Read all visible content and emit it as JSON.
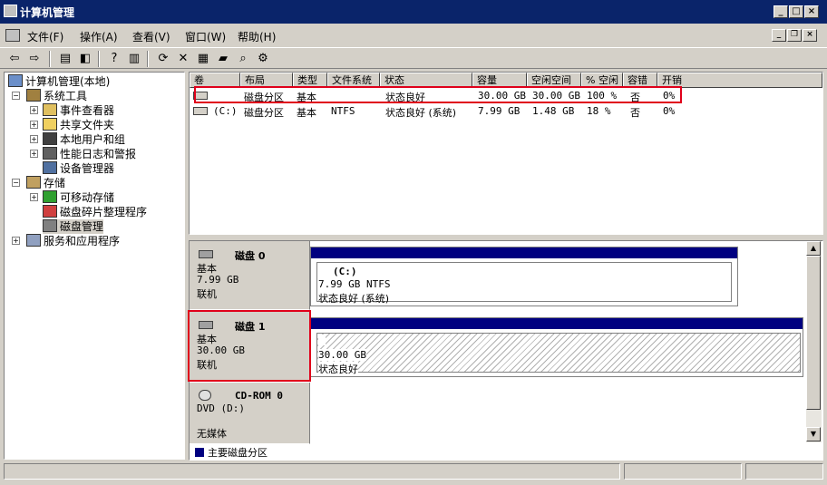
{
  "window": {
    "title": "计算机管理"
  },
  "menu": [
    {
      "label": "文件(F)"
    },
    {
      "label": "操作(A)"
    },
    {
      "label": "查看(V)"
    },
    {
      "label": "窗口(W)"
    },
    {
      "label": "帮助(H)"
    }
  ],
  "tree": {
    "root": "计算机管理(本地)",
    "system_tools": "系统工具",
    "event_viewer": "事件查看器",
    "shared_folders": "共享文件夹",
    "local_users": "本地用户和组",
    "perf_logs": "性能日志和警报",
    "device_manager": "设备管理器",
    "storage": "存储",
    "removable": "可移动存储",
    "defrag": "磁盘碎片整理程序",
    "disk_mgmt": "磁盘管理",
    "services": "服务和应用程序"
  },
  "volume_list": {
    "headers": [
      "卷",
      "布局",
      "类型",
      "文件系统",
      "状态",
      "容量",
      "空闲空间",
      "% 空闲",
      "容错",
      "开销"
    ],
    "rows": [
      [
        "",
        "磁盘分区",
        "基本",
        "",
        "状态良好",
        "30.00 GB",
        "30.00 GB",
        "100 %",
        "否",
        "0%"
      ],
      [
        "(C:)",
        "磁盘分区",
        "基本",
        "NTFS",
        "状态良好 (系统)",
        "7.99 GB",
        "1.48 GB",
        "18 %",
        "否",
        "0%"
      ]
    ]
  },
  "disks": [
    {
      "name": "磁盘 0",
      "type": "基本",
      "size": "7.99 GB",
      "status": "联机",
      "vol_name": "(C:)",
      "vol_size": "7.99 GB NTFS",
      "vol_status": "状态良好 (系统)"
    },
    {
      "name": "磁盘 1",
      "type": "基本",
      "size": "30.00 GB",
      "status": "联机",
      "vol_size": "30.00 GB",
      "vol_status": "状态良好"
    },
    {
      "name": "CD-ROM 0",
      "type": "DVD (D:)",
      "status": "无媒体"
    }
  ],
  "legend": {
    "primary": "主要磁盘分区",
    "primary_color": "#000080"
  },
  "colors": {
    "titlebar": "#0a246a",
    "highlight": "#e0001a"
  }
}
